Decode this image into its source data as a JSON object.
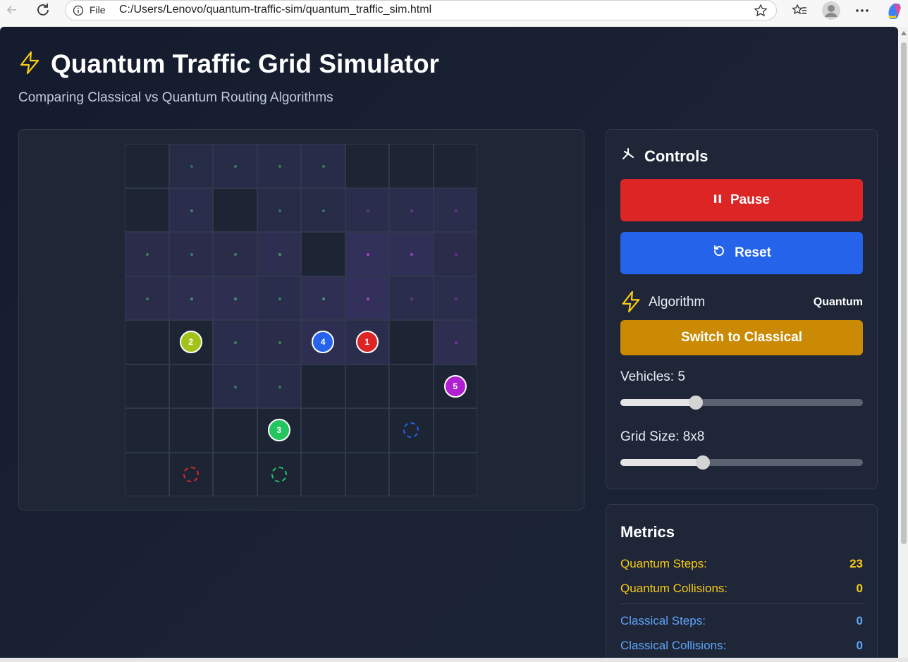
{
  "browser": {
    "scheme": "File",
    "url": "C:/Users/Lenovo/quantum-traffic-sim/quantum_traffic_sim.html"
  },
  "header": {
    "title": "Quantum Traffic Grid Simulator",
    "subtitle": "Comparing Classical vs Quantum Routing Algorithms"
  },
  "grid": {
    "rows": 8,
    "cols": 8,
    "probability_overlay": [
      [
        0.0,
        0.05,
        0.15,
        0.15,
        0.15,
        0.0,
        0.0,
        0.0
      ],
      [
        0.0,
        0.25,
        0.0,
        0.1,
        0.1,
        0.25,
        0.3,
        0.3
      ],
      [
        0.2,
        0.2,
        0.2,
        0.4,
        0.0,
        0.6,
        0.5,
        0.2
      ],
      [
        0.2,
        0.4,
        0.4,
        0.25,
        0.45,
        0.65,
        0.25,
        0.25
      ],
      [
        0.0,
        0.0,
        0.25,
        0.2,
        0.4,
        0.3,
        0.0,
        0.4
      ],
      [
        0.0,
        0.0,
        0.15,
        0.15,
        0.0,
        0.0,
        0.0,
        0.0
      ],
      [
        0.0,
        0.0,
        0.0,
        0.0,
        0.0,
        0.0,
        0.0,
        0.0
      ],
      [
        0.0,
        0.0,
        0.0,
        0.0,
        0.0,
        0.0,
        0.0,
        0.0
      ]
    ],
    "vehicles": [
      {
        "label": "1",
        "row": 4,
        "col": 5,
        "color": "#dc2626"
      },
      {
        "label": "2",
        "row": 4,
        "col": 1,
        "color": "#a3c31a"
      },
      {
        "label": "3",
        "row": 6,
        "col": 3,
        "color": "#22c55e"
      },
      {
        "label": "4",
        "row": 4,
        "col": 4,
        "color": "#2563eb"
      },
      {
        "label": "5",
        "row": 5,
        "col": 7,
        "color": "#b020d0"
      }
    ],
    "targets": [
      {
        "row": 7,
        "col": 1,
        "color": "#dc2626"
      },
      {
        "row": 7,
        "col": 3,
        "color": "#22c55e"
      },
      {
        "row": 6,
        "col": 6,
        "color": "#2563eb"
      }
    ]
  },
  "controls": {
    "title": "Controls",
    "pause_label": "Pause",
    "reset_label": "Reset",
    "algorithm_label": "Algorithm",
    "algorithm_value": "Quantum",
    "switch_label": "Switch to Classical",
    "vehicles_label": "Vehicles: 5",
    "vehicles_level": 0.31,
    "grid_label": "Grid Size: 8x8",
    "grid_level": 0.34
  },
  "metrics": {
    "title": "Metrics",
    "rows": [
      {
        "key": "Quantum Steps:",
        "value": "23",
        "kind": "q"
      },
      {
        "key": "Quantum Collisions:",
        "value": "0",
        "kind": "q"
      },
      {
        "key": "Classical Steps:",
        "value": "0",
        "kind": "c"
      },
      {
        "key": "Classical Collisions:",
        "value": "0",
        "kind": "c"
      }
    ]
  },
  "colors": {
    "accent_yellow": "#facc15",
    "pause_red": "#dc2626",
    "reset_blue": "#2563eb",
    "switch_gold": "#ca8a04"
  }
}
